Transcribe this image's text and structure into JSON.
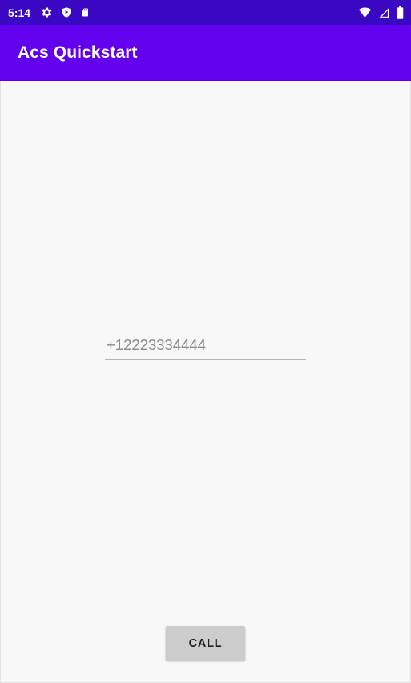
{
  "app": {
    "title": "Acs Quickstart",
    "accent_color": "#6200ee",
    "status_bar_color": "#3a07c2",
    "content_background": "#f8f8f8"
  },
  "status_bar": {
    "time": "5:14",
    "left_icons": [
      {
        "name": "settings-gear-icon",
        "label": "Settings"
      },
      {
        "name": "play-protect-shield-icon",
        "label": "Play Protect"
      },
      {
        "name": "sd-card-icon",
        "label": "SD Card"
      }
    ],
    "right_icons": [
      {
        "name": "wifi-icon",
        "label": "Wi-Fi"
      },
      {
        "name": "cellular-signal-icon",
        "label": "Signal"
      },
      {
        "name": "battery-icon",
        "label": "Battery"
      }
    ]
  },
  "main": {
    "phone_input": {
      "value": "",
      "placeholder": "+12223334444",
      "placeholder_color": "#8a8a8a",
      "underline_color": "#b3b3b3"
    },
    "call_button": {
      "label": "CALL",
      "background": "#cccccc",
      "text_color": "#1c1c1c"
    }
  }
}
